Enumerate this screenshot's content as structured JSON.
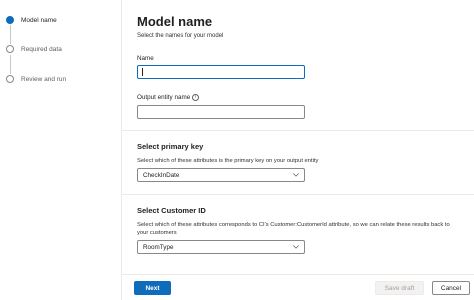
{
  "stepper": {
    "steps": [
      {
        "label": "Model name",
        "active": true
      },
      {
        "label": "Required data",
        "active": false
      },
      {
        "label": "Review and run",
        "active": false
      }
    ]
  },
  "page": {
    "title": "Model name",
    "subtitle": "Select the names for your model"
  },
  "form": {
    "name_label": "Name",
    "name_value": "",
    "output_label": "Output entity name",
    "output_value": ""
  },
  "primary_key": {
    "title": "Select primary key",
    "description": "Select which of these attributes is the primary key on your output entity",
    "selected": "CheckInDate"
  },
  "customer_id": {
    "title": "Select Customer ID",
    "description": "Select which of these attributes corresponds to CI's Customer:CustomerId attribute, so we can relate these results back to your customers",
    "selected": "RoomType"
  },
  "footer": {
    "next_label": "Next",
    "save_draft_label": "Save draft",
    "cancel_label": "Cancel"
  },
  "colors": {
    "accent": "#0f6cbd",
    "border": "#8a8886",
    "divider": "#edebe9"
  }
}
